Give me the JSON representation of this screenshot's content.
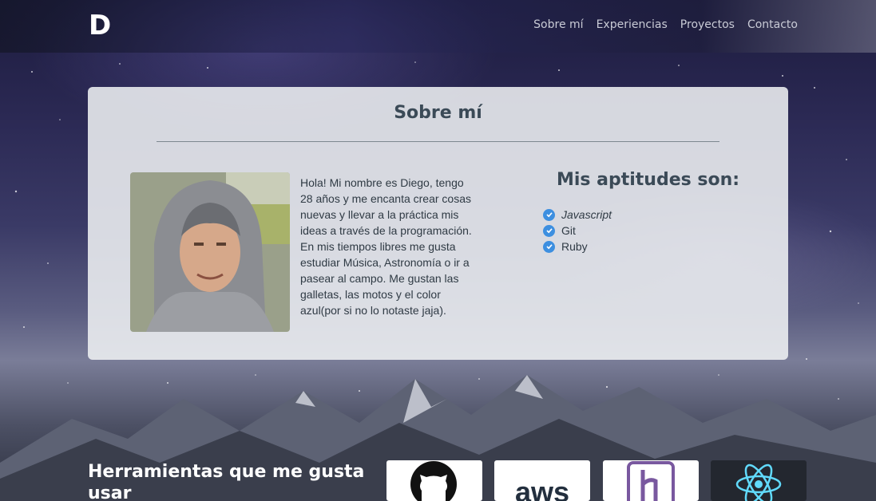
{
  "navbar": {
    "brand": "D",
    "links": [
      "Sobre mí",
      "Experiencias",
      "Proyectos",
      "Contacto"
    ]
  },
  "about": {
    "title": "Sobre mí",
    "bio": "Hola! Mi nombre es Diego, tengo 28 años y me encanta crear cosas nuevas y llevar a la práctica mis ideas a través de la programación. En mis tiempos libres me gusta estudiar Música, Astronomía o ir a pasear al campo. Me gustan las galletas, las motos y el color azul(por si no lo notaste jaja).",
    "skills_title": "Mis aptitudes son:",
    "skills": [
      "Javascript",
      "Git",
      "Ruby"
    ]
  },
  "tools": {
    "title": "Herramientas que me gusta usar",
    "logos": [
      "github-icon",
      "aws-logo",
      "heroku-logo",
      "react-icon"
    ],
    "aws_text": "aws"
  },
  "colors": {
    "accent": "#3d8fe0",
    "card_bg": "#eef0f3",
    "heading": "#3b4a57"
  }
}
